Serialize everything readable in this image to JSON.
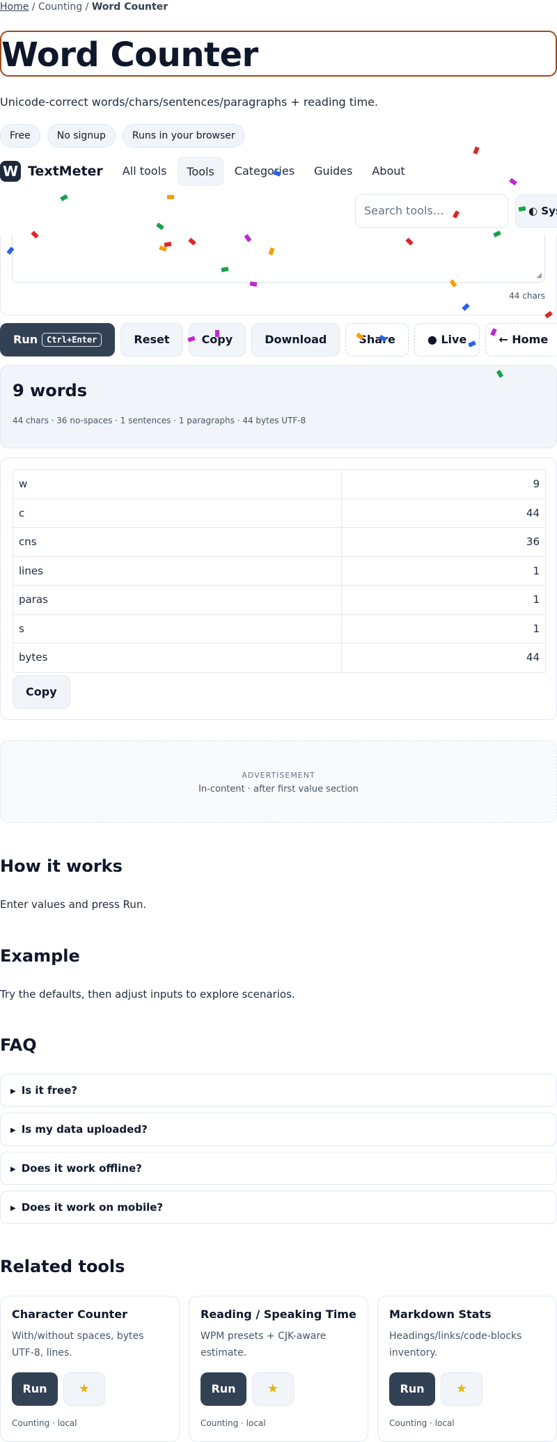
{
  "breadcrumb": {
    "home": "Home",
    "sep1": " / ",
    "category": "Counting",
    "sep2": " / ",
    "current": "Word Counter"
  },
  "page": {
    "title": "Word Counter",
    "subtitle": "Unicode-correct words/chars/sentences/paragraphs + reading time."
  },
  "badges": [
    "Free",
    "No signup",
    "Runs in your browser"
  ],
  "nav": {
    "logo_letter": "W",
    "brand": "TextMeter",
    "links": [
      "All tools",
      "Tools",
      "Categories",
      "Guides",
      "About"
    ],
    "search_placeholder": "Search tools…",
    "theme_label": "◐ System"
  },
  "editor": {
    "char_count": "44 chars"
  },
  "actions": {
    "run": "Run",
    "run_shortcut": "Ctrl+Enter",
    "reset": "Reset",
    "copy": "Copy",
    "download": "Download",
    "share": "Share",
    "live": "● Live",
    "home": "← Home"
  },
  "summary": {
    "headline": "9 words",
    "meta": "44 chars · 36 no-spaces · 1 sentences · 1 paragraphs · 44 bytes UTF-8"
  },
  "stats": {
    "rows": [
      {
        "key": "w",
        "value": "9"
      },
      {
        "key": "c",
        "value": "44"
      },
      {
        "key": "cns",
        "value": "36"
      },
      {
        "key": "lines",
        "value": "1"
      },
      {
        "key": "paras",
        "value": "1"
      },
      {
        "key": "s",
        "value": "1"
      },
      {
        "key": "bytes",
        "value": "44"
      }
    ],
    "copy": "Copy"
  },
  "ad": {
    "label": "ADVERTISEMENT",
    "sub": "In-content · after first value section"
  },
  "how": {
    "title": "How it works",
    "body": "Enter values and press Run."
  },
  "example": {
    "title": "Example",
    "body": "Try the defaults, then adjust inputs to explore scenarios."
  },
  "faq": {
    "title": "FAQ",
    "items": [
      "Is it free?",
      "Is my data uploaded?",
      "Does it work offline?",
      "Does it work on mobile?"
    ]
  },
  "related": {
    "title": "Related tools",
    "items": [
      {
        "name": "Character Counter",
        "desc": "With/without spaces, bytes UTF-8, lines.",
        "run": "Run",
        "foot": "Counting · local"
      },
      {
        "name": "Reading / Speaking Time",
        "desc": "WPM presets + CJK-aware estimate.",
        "run": "Run",
        "foot": "Counting · local"
      },
      {
        "name": "Markdown Stats",
        "desc": "Headings/links/code-blocks inventory.",
        "run": "Run",
        "foot": "Counting · local"
      }
    ]
  },
  "colors": {
    "accent": "#334155",
    "title_border": "#a04a1b",
    "surface": "#f1f5f9",
    "star": "#eab308"
  },
  "icons": {
    "faq_toggle": "triangle-right-icon",
    "favorite": "star-icon",
    "theme": "half-circle-icon"
  }
}
